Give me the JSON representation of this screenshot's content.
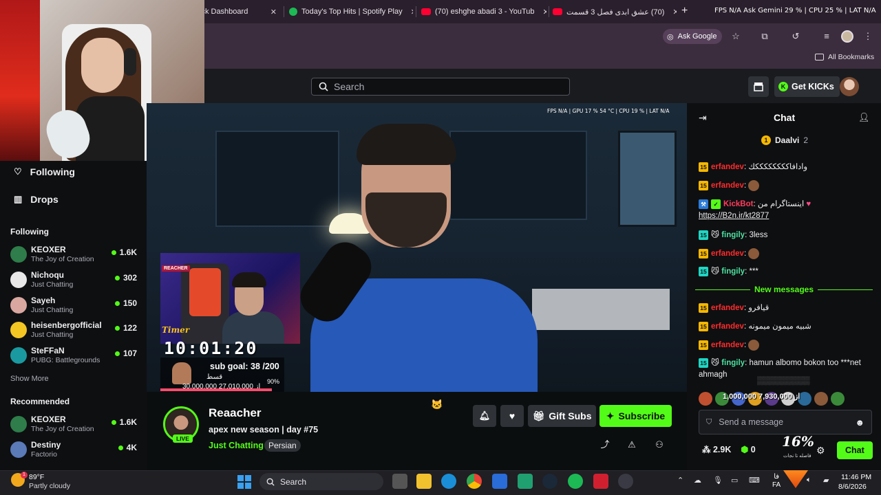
{
  "browser": {
    "tabs": [
      {
        "title": "ick Dashboard"
      },
      {
        "title": "Today's Top Hits | Spotify Play"
      },
      {
        "title": "(70) eshghe abadi 3 - YouTub"
      },
      {
        "title": "(70) عشق ابدی فصل 3 قسمت"
      }
    ],
    "perf_overlay": "FPS  N/A  Ask Gemini  29 %  |  CPU  25 %  |  LAT  N/A",
    "ask_google": "Ask Google",
    "all_bookmarks": "All Bookmarks"
  },
  "header": {
    "search_placeholder": "Search",
    "get_kicks": "Get KICKs"
  },
  "sidebar": {
    "nav": [
      {
        "label": "Following"
      },
      {
        "label": "Drops"
      }
    ],
    "following_heading": "Following",
    "following": [
      {
        "name": "KEOXER",
        "category": "The Joy of Creation",
        "viewers": "1.6K"
      },
      {
        "name": "Nichoqu",
        "category": "Just Chatting",
        "viewers": "302"
      },
      {
        "name": "Sayeh",
        "category": "Just Chatting",
        "viewers": "150"
      },
      {
        "name": "heisenbergofficial",
        "category": "Just Chatting",
        "viewers": "122"
      },
      {
        "name": "SteFFaN",
        "category": "PUBG: Battlegrounds",
        "viewers": "107"
      }
    ],
    "show_more": "Show More",
    "recommended_heading": "Recommended",
    "recommended": [
      {
        "name": "KEOXER",
        "category": "The Joy of Creation",
        "viewers": "1.6K"
      },
      {
        "name": "Destiny",
        "category": "Factorio",
        "viewers": "4K"
      }
    ]
  },
  "video": {
    "overlay_stats": "FPS  N/A  |  GPU  17 %  54 °C  |  CPU  19 %  |  LAT  N/A",
    "inset_label": "REACHER",
    "timer_label": "Timer",
    "timer_value": "10:01:20",
    "subgoal_text": "sub goal: 38 /200",
    "subgoal_fa": "قسط",
    "subgoal_pct": "90%",
    "subgoal_money": "30,000,000 از 27,010,000",
    "subgoal_progress": 0.9
  },
  "stream": {
    "streamer_name": "Reaacher",
    "live_badge": "LIVE",
    "title": "apex new season | day #75",
    "category": "Just Chatting",
    "tag": "Persian",
    "gift_subs": "Gift Subs",
    "subscribe": "Subscribe"
  },
  "chat": {
    "title": "Chat",
    "pinned_user": "Daalvi",
    "pinned_count": "2",
    "messages": [
      {
        "badge": "15",
        "user": "erfandev",
        "text": "وادافاككككككككك"
      },
      {
        "badge": "15",
        "user": "erfandev",
        "text": ""
      },
      {
        "badge": "",
        "user": "KickBot",
        "text": "اینستاگرام من",
        "link": "https://B2n.ir/kt2877"
      },
      {
        "badge": "15",
        "user": "fingily",
        "text": "3less"
      },
      {
        "badge": "15",
        "user": "erfandev",
        "text": ""
      },
      {
        "badge": "15",
        "user": "fingily",
        "text": "***"
      },
      {
        "badge": "15",
        "user": "erfandev",
        "text": "قيافرو"
      },
      {
        "badge": "15",
        "user": "erfandev",
        "text": "شبیه میمون میمونه"
      },
      {
        "badge": "15",
        "user": "erfandev",
        "text": ""
      },
      {
        "badge": "15",
        "user": "fingily",
        "text": "hamun albomo bokon too ***net ahmagh"
      }
    ],
    "new_messages": "New messages",
    "overlay_text": "1,000,000 از 7,930,000",
    "input_placeholder": "Send a message",
    "viewers": "2.9K",
    "kicks": "0",
    "send": "Chat",
    "overlay_pct": "16%",
    "overlay_pct_sub": "فاصله تا نجات"
  },
  "taskbar": {
    "temp": "89°F",
    "weather": "Partly cloudy",
    "search": "Search",
    "lang": "فا",
    "lang2": "FA",
    "time": "11:46 PM",
    "date": "8/6/2026",
    "weather_badge": "1"
  },
  "colors": {
    "kick_green": "#53fc18",
    "chat_user_red": "#ff2c2c",
    "chat_user_teal": "#4ee0a0"
  }
}
